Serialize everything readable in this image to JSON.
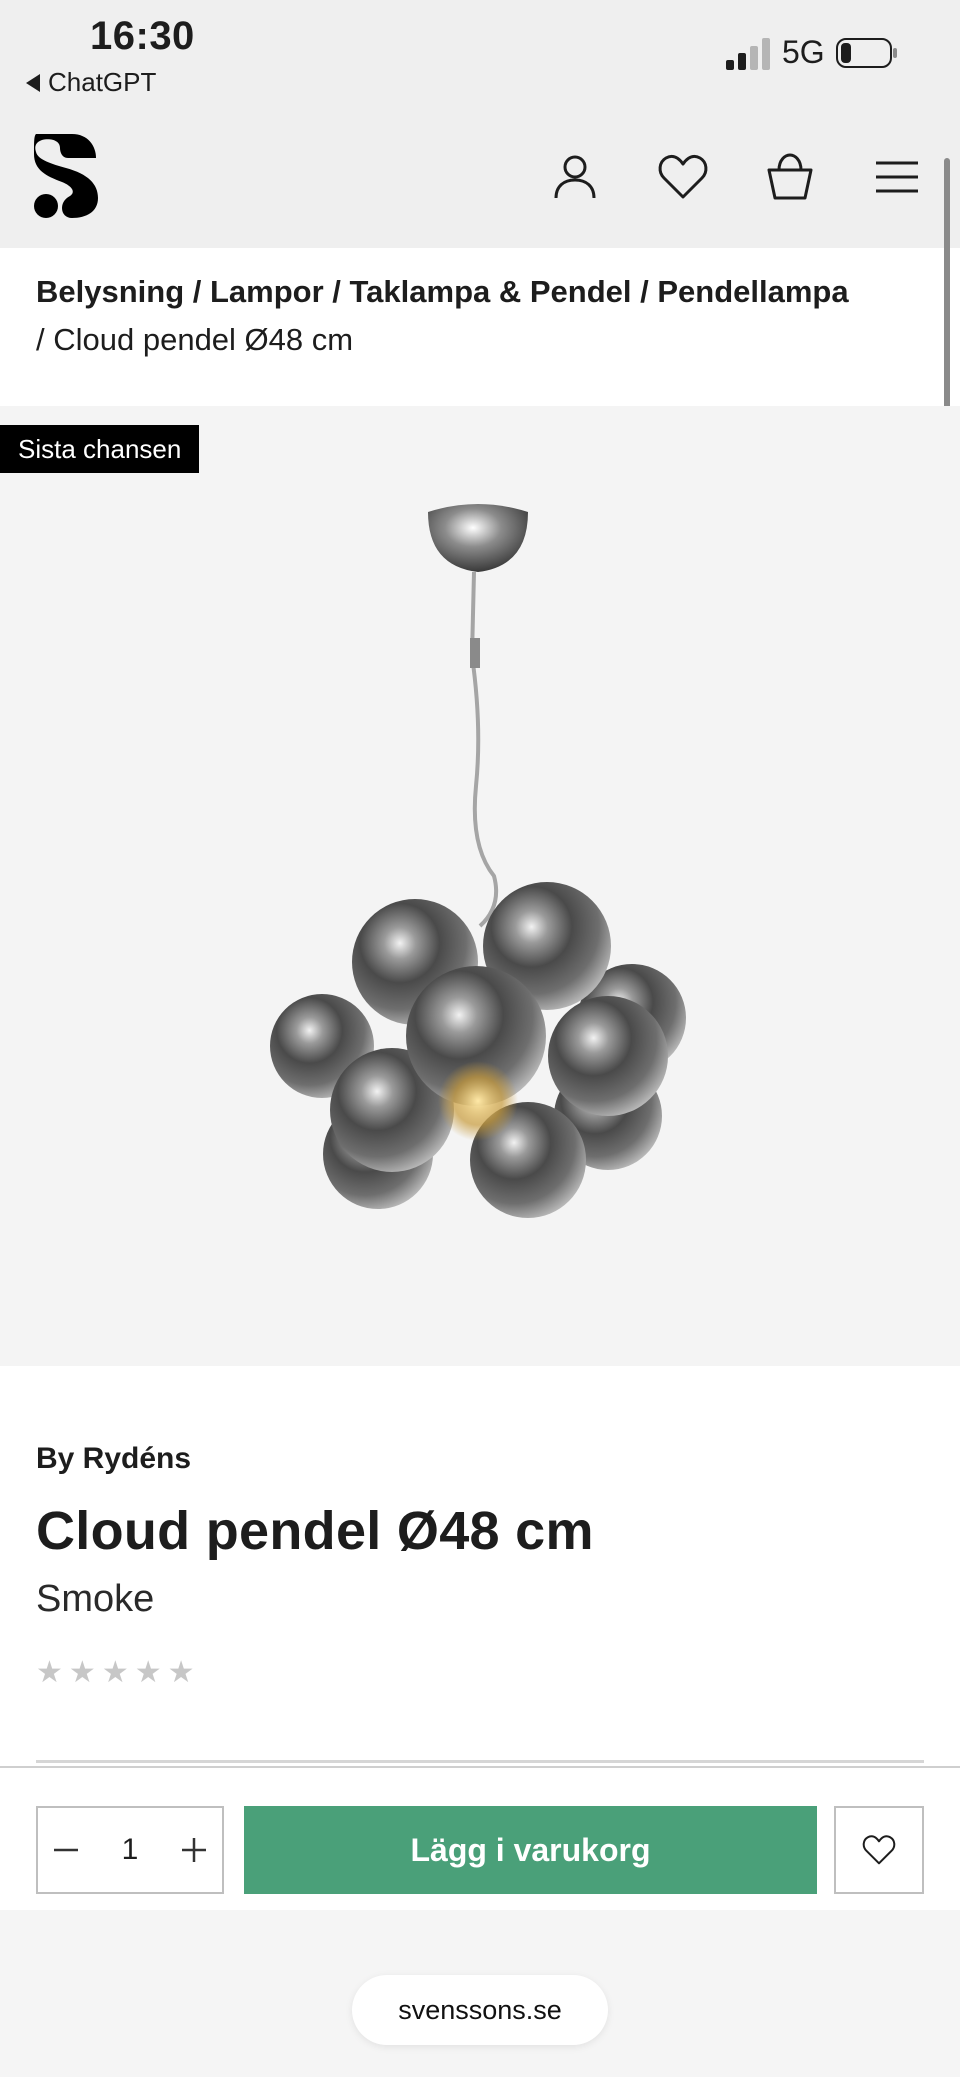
{
  "status_bar": {
    "time": "16:30",
    "back_app": "ChatGPT",
    "network": "5G"
  },
  "header": {
    "icons": [
      "account-icon",
      "heart-icon",
      "cart-icon",
      "menu-icon"
    ]
  },
  "breadcrumb": {
    "links": [
      "Belysning",
      "Lampor",
      "Taklampa & Pendel",
      "Pendellampa"
    ],
    "separator": " / ",
    "current": "Cloud pendel Ø48 cm"
  },
  "badge": "Sista chansen",
  "product": {
    "brand": "By Rydéns",
    "name": "Cloud pendel Ø48 cm",
    "variant": "Smoke",
    "rating": 0,
    "rating_max": 5
  },
  "actions": {
    "quantity": "1",
    "minus": "−",
    "plus": "+",
    "add_to_cart": "Lägg i varukorg"
  },
  "browser": {
    "url": "svenssons.se"
  },
  "colors": {
    "accent": "#4aa079",
    "badge_bg": "#000000",
    "star_empty": "#c7c7c7"
  }
}
